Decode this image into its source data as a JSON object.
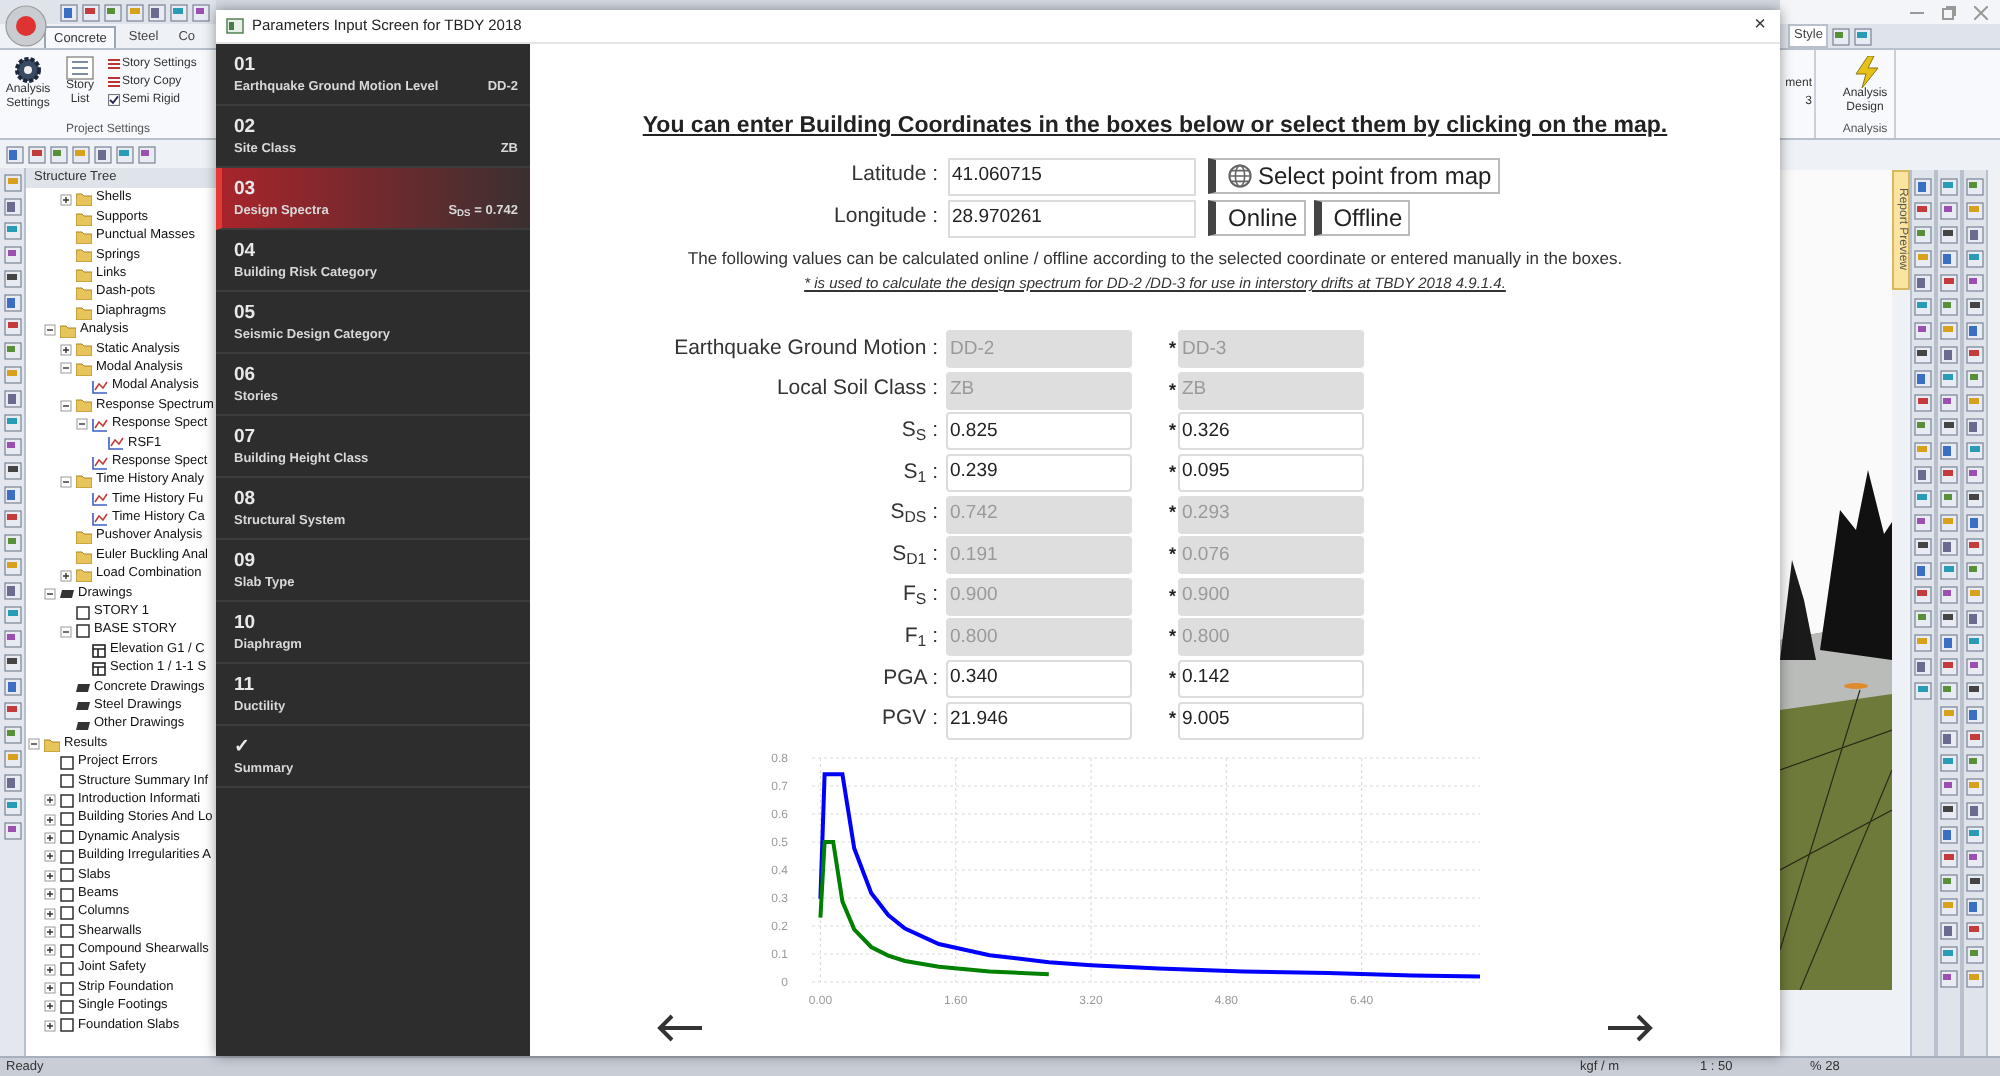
{
  "app": {
    "ribbon_tabs": [
      {
        "label": "Concrete",
        "selected": true
      },
      {
        "label": "Steel",
        "selected": false
      },
      {
        "label": "Co",
        "selected": false
      }
    ],
    "project_settings": {
      "buttons": [
        {
          "label": "Analysis Settings",
          "kind": "gear"
        },
        {
          "label": "Story List",
          "kind": "list"
        }
      ],
      "commands": [
        {
          "label": "Story Settings",
          "kind": "button"
        },
        {
          "label": "Story Copy",
          "kind": "button"
        },
        {
          "label": "Semi Rigid",
          "kind": "checkbox",
          "checked": true
        }
      ],
      "group": "Project Settings"
    },
    "right_ribbon": {
      "style_label": "Style",
      "cut_label": "ment",
      "cut_label_2": "3",
      "analysis_button": "Analysis Design",
      "group": "Analysis"
    },
    "tree_title": "Structure Tree",
    "model_items": [
      {
        "label": "Shells",
        "kind": "folder",
        "expanded": false
      },
      {
        "label": "Supports",
        "kind": "folder"
      },
      {
        "label": "Punctual Masses",
        "kind": "folder"
      },
      {
        "label": "Springs",
        "kind": "folder"
      },
      {
        "label": "Links",
        "kind": "folder"
      },
      {
        "label": "Dash-pots",
        "kind": "folder"
      },
      {
        "label": "Diaphragms",
        "kind": "folder"
      }
    ],
    "tree": [
      {
        "label": "Analysis",
        "kind": "folder",
        "expanded": true,
        "children": [
          {
            "label": "Static Analysis",
            "kind": "folder",
            "expanded": false
          },
          {
            "label": "Modal Analysis",
            "kind": "folder",
            "expanded": true,
            "children": [
              {
                "label": "Modal Analysis",
                "kind": "chart"
              }
            ]
          },
          {
            "label": "Response Spectrum",
            "kind": "folder",
            "expanded": true,
            "children": [
              {
                "label": "Response Spect",
                "kind": "chart",
                "expanded": true,
                "children": [
                  {
                    "label": "RSF1",
                    "kind": "chart"
                  }
                ]
              },
              {
                "label": "Response Spect",
                "kind": "chart"
              }
            ]
          },
          {
            "label": "Time History Analy",
            "kind": "folder",
            "expanded": true,
            "children": [
              {
                "label": "Time History Fu",
                "kind": "chart"
              },
              {
                "label": "Time History Ca",
                "kind": "chart"
              }
            ]
          },
          {
            "label": "Pushover Analysis",
            "kind": "folder"
          },
          {
            "label": "Euler Buckling Anal",
            "kind": "folder"
          },
          {
            "label": "Load Combination",
            "kind": "folder",
            "expanded": false
          }
        ]
      },
      {
        "label": "Drawings",
        "kind": "drawing",
        "expanded": true,
        "children": [
          {
            "label": "STORY 1",
            "kind": "page"
          },
          {
            "label": "BASE STORY",
            "kind": "page",
            "expanded": true,
            "children": [
              {
                "label": "Elevation G1 / C",
                "kind": "sheet"
              },
              {
                "label": "Section 1 / 1-1 S",
                "kind": "sheet"
              }
            ]
          },
          {
            "label": "Concrete Drawings",
            "kind": "drawing"
          },
          {
            "label": "Steel Drawings",
            "kind": "drawing"
          },
          {
            "label": "Other Drawings",
            "kind": "drawing"
          }
        ]
      }
    ],
    "results": [
      {
        "label": "Results",
        "kind": "folder",
        "expanded": true,
        "children": [
          {
            "label": "Project Errors",
            "kind": "page"
          },
          {
            "label": "Structure Summary Inf",
            "kind": "page"
          },
          {
            "label": "Introduction Informati",
            "kind": "page",
            "expanded": false
          },
          {
            "label": "Building Stories And Lo",
            "kind": "page",
            "expanded": false
          },
          {
            "label": "Dynamic Analysis",
            "kind": "page",
            "expanded": false
          },
          {
            "label": "Building Irregularities A",
            "kind": "page",
            "expanded": false
          },
          {
            "label": "Slabs",
            "kind": "page",
            "expanded": false
          },
          {
            "label": "Beams",
            "kind": "page",
            "expanded": false
          },
          {
            "label": "Columns",
            "kind": "page",
            "expanded": false
          },
          {
            "label": "Shearwalls",
            "kind": "page",
            "expanded": false
          },
          {
            "label": "Compound Shearwalls",
            "kind": "page",
            "expanded": false
          },
          {
            "label": "Joint Safety",
            "kind": "page",
            "expanded": false
          },
          {
            "label": "Strip Foundation",
            "kind": "page",
            "expanded": false
          },
          {
            "label": "Single Footings",
            "kind": "page",
            "expanded": false
          },
          {
            "label": "Foundation Slabs",
            "kind": "page",
            "expanded": false
          }
        ]
      }
    ],
    "report_tab": "Report Preview",
    "status": {
      "left": "Ready",
      "units": "kgf / m",
      "scale": "1 : 50",
      "zoom": "% 28"
    }
  },
  "dialog": {
    "title": "Parameters Input Screen for TBDY 2018",
    "close": "×",
    "steps": [
      {
        "number": "01",
        "label": "Earthquake Ground Motion Level",
        "value": "DD-2",
        "selected": false
      },
      {
        "number": "02",
        "label": "Site Class",
        "value": "ZB",
        "selected": false
      },
      {
        "number": "03",
        "label": "Design Spectra",
        "value": "S$_{DS}$ = 0.742",
        "selected": true
      },
      {
        "number": "04",
        "label": "Building Risk Category",
        "selected": false
      },
      {
        "number": "05",
        "label": "Seismic Design Category",
        "selected": false
      },
      {
        "number": "06",
        "label": "Stories",
        "selected": false
      },
      {
        "number": "07",
        "label": "Building Height Class",
        "selected": false
      },
      {
        "number": "08",
        "label": "Structural System",
        "selected": false
      },
      {
        "number": "09",
        "label": "Slab Type",
        "selected": false
      },
      {
        "number": "10",
        "label": "Diaphragm",
        "selected": false
      },
      {
        "number": "11",
        "label": "Ductility",
        "selected": false
      },
      {
        "number": "✓",
        "label": "Summary",
        "selected": false
      }
    ],
    "heading": "You can enter Building Coordinates in the boxes below or select them by clicking on the map.",
    "coordinates": [
      {
        "label": "Latitude :",
        "value": "41.060715"
      },
      {
        "label": "Longitude :",
        "value": "28.970261"
      }
    ],
    "buttons": [
      {
        "label": "Select point from map",
        "kind": "map"
      },
      {
        "label": "Online",
        "kind": "plain"
      },
      {
        "label": "Offline",
        "kind": "plain"
      }
    ],
    "note": "The following values can be calculated online / offline according to the selected coordinate or entered manually in the boxes.",
    "note_2": "* is used to calculate the design spectrum for DD-2 /DD-3 for use in interstory drifts at TBDY 2018 4.9.1.4.",
    "params": [
      {
        "label": "Earthquake Ground Motion :",
        "value": "DD-2",
        "disabled": true,
        "marker": "*",
        "value_2": "DD-3",
        "disabled_2": true
      },
      {
        "label": "Local Soil Class :",
        "value": "ZB",
        "disabled": true,
        "marker": "*",
        "value_2": "ZB",
        "disabled_2": true
      },
      {
        "label": "S$_{S}$ :",
        "value": "0.825",
        "disabled": false,
        "marker": "*",
        "value_2": "0.326",
        "disabled_2": false
      },
      {
        "label": "S$_{1}$ :",
        "value": "0.239",
        "disabled": false,
        "marker": "*",
        "value_2": "0.095",
        "disabled_2": false
      },
      {
        "label": "S$_{DS}$ :",
        "value": "0.742",
        "disabled": true,
        "marker": "*",
        "value_2": "0.293",
        "disabled_2": true
      },
      {
        "label": "S$_{D1}$ :",
        "value": "0.191",
        "disabled": true,
        "marker": "*",
        "value_2": "0.076",
        "disabled_2": true
      },
      {
        "label": "F$_{S}$ :",
        "value": "0.900",
        "disabled": true,
        "marker": "*",
        "value_2": "0.900",
        "disabled_2": true
      },
      {
        "label": "F$_{1}$ :",
        "value": "0.800",
        "disabled": true,
        "marker": "*",
        "value_2": "0.800",
        "disabled_2": true
      },
      {
        "label": "PGA :",
        "value": "0.340",
        "disabled": false,
        "marker": "*",
        "value_2": "0.142",
        "disabled_2": false
      },
      {
        "label": "PGV :",
        "value": "21.946",
        "disabled": false,
        "marker": "*",
        "value_2": "9.005",
        "disabled_2": false
      }
    ],
    "chart_data": {
      "type": "line",
      "x": [
        0,
        0.05,
        0.15,
        0.26,
        0.4,
        0.6,
        0.8,
        1.0,
        1.4,
        2.0,
        2.7,
        3.2,
        4.0,
        5.0,
        6.0,
        7.0,
        7.8
      ],
      "series": [
        {
          "color": "#0000ff",
          "values": [
            0.297,
            0.742,
            0.742,
            0.742,
            0.478,
            0.318,
            0.239,
            0.191,
            0.136,
            0.096,
            0.071,
            0.06,
            0.048,
            0.038,
            0.032,
            0.023,
            0.019
          ]
        },
        {
          "color": "#008000",
          "values": [
            0.23,
            0.5,
            0.5,
            0.288,
            0.188,
            0.125,
            0.094,
            0.075,
            0.054,
            0.038,
            0.028,
            null,
            null,
            null,
            null,
            null,
            null
          ]
        }
      ],
      "grid": true,
      "xlim": [
        -0.1,
        7.8
      ],
      "ylim": [
        0,
        0.8
      ],
      "xticks": [
        {
          "value": 0,
          "label": "0.00"
        },
        {
          "value": 1.6,
          "label": "1.60"
        },
        {
          "value": 3.2,
          "label": "3.20"
        },
        {
          "value": 4.8,
          "label": "4.80"
        },
        {
          "value": 6.4,
          "label": "6.40"
        }
      ],
      "yticks": [
        0,
        0.1,
        0.2,
        0.3,
        0.4,
        0.5,
        0.6,
        0.7,
        0.8
      ]
    }
  }
}
